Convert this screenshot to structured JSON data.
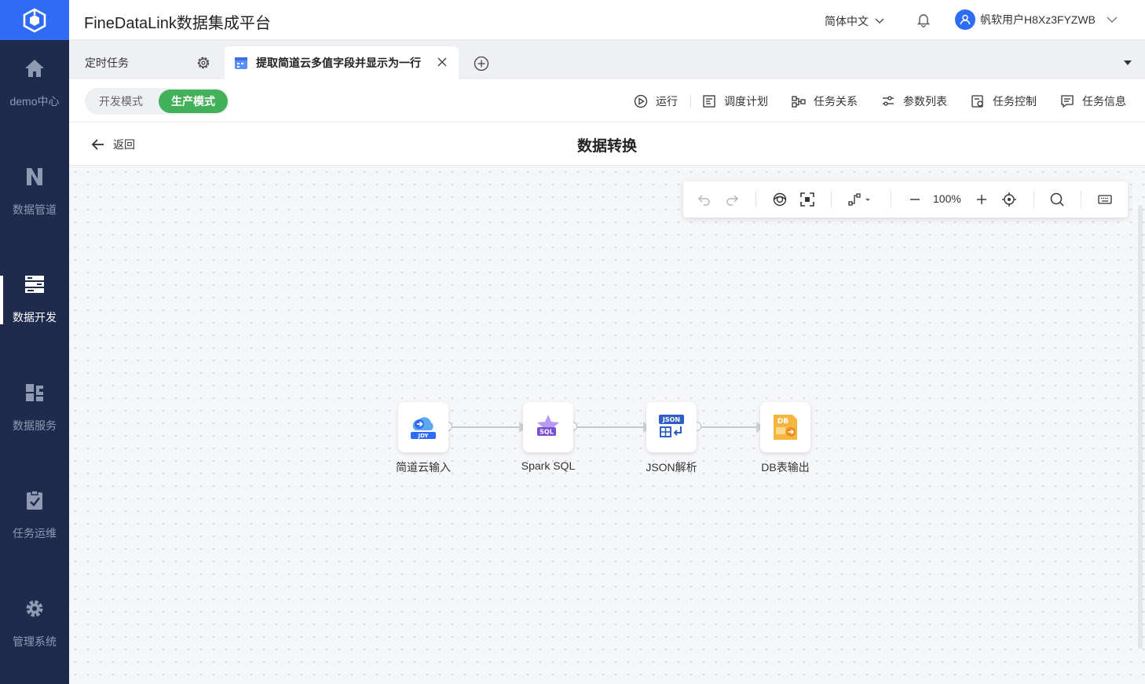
{
  "app": {
    "title": "FineDataLink数据集成平台"
  },
  "header": {
    "language": "简体中文",
    "username": "帆软用户H8Xz3FYZWB"
  },
  "sidebar": {
    "items": [
      {
        "label": "demo中心",
        "icon": "home-icon"
      },
      {
        "label": "数据管道",
        "icon": "pipeline-icon"
      },
      {
        "label": "数据开发",
        "icon": "dev-icon",
        "active": true
      },
      {
        "label": "数据服务",
        "icon": "service-icon"
      },
      {
        "label": "任务运维",
        "icon": "ops-icon"
      },
      {
        "label": "管理系统",
        "icon": "gear-icon"
      }
    ]
  },
  "tabs": [
    {
      "label": "定时任务"
    },
    {
      "label": "提取简道云多值字段并显示为一行",
      "active": true
    }
  ],
  "modes": {
    "dev": "开发模式",
    "prod": "生产模式",
    "selected": "prod"
  },
  "actions": {
    "run": "运行",
    "schedule": "调度计划",
    "relation": "任务关系",
    "params": "参数列表",
    "control": "任务控制",
    "info": "任务信息"
  },
  "page": {
    "back": "返回",
    "title": "数据转换"
  },
  "canvas": {
    "zoom": "100%"
  },
  "flow": {
    "nodes": [
      {
        "label": "简道云输入",
        "badge": "JDY"
      },
      {
        "label": "Spark SQL",
        "badge": "SQL"
      },
      {
        "label": "JSON解析",
        "badge": "JSON"
      },
      {
        "label": "DB表输出",
        "badge": "DB"
      }
    ]
  },
  "colors": {
    "sidebar": "#1e2b4d",
    "brand": "#2f6cf6",
    "prod_green": "#43b15a"
  }
}
